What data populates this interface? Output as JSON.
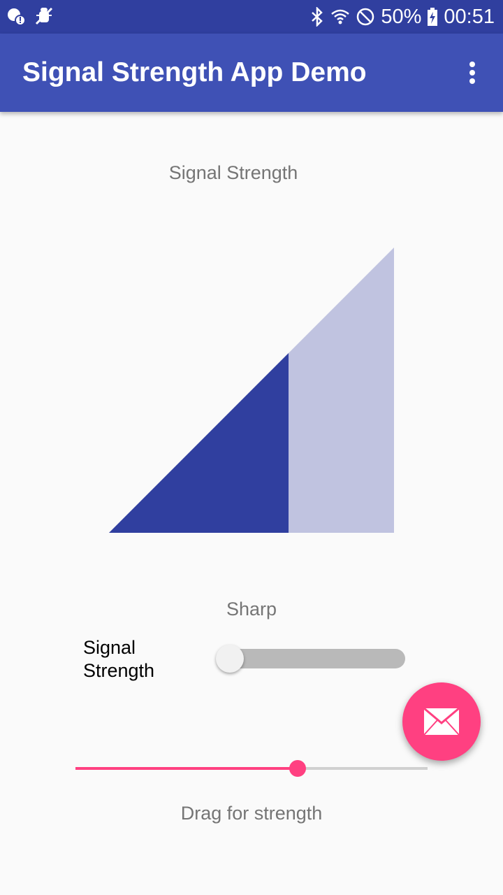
{
  "status_bar": {
    "battery": "50%",
    "time": "00:51",
    "icons": [
      "notification-icon",
      "debug-icon",
      "bluetooth-icon",
      "wifi-icon",
      "do-not-disturb-icon",
      "battery-charging-icon"
    ]
  },
  "app_bar": {
    "title": "Signal Strength App Demo",
    "menu_icon": "overflow-menu-icon"
  },
  "gauge": {
    "title": "Signal Strength",
    "level": 0.63,
    "filled_color": "#303f9f",
    "empty_color": "#c0c3e0"
  },
  "style_toggle": {
    "label": "Sharp",
    "switch_label": "Signal Strength",
    "checked": false
  },
  "strength_slider": {
    "value": 0.63,
    "caption": "Drag for strength",
    "accent": "#ff4081"
  },
  "fab": {
    "icon": "email-icon",
    "color": "#ff4081"
  }
}
